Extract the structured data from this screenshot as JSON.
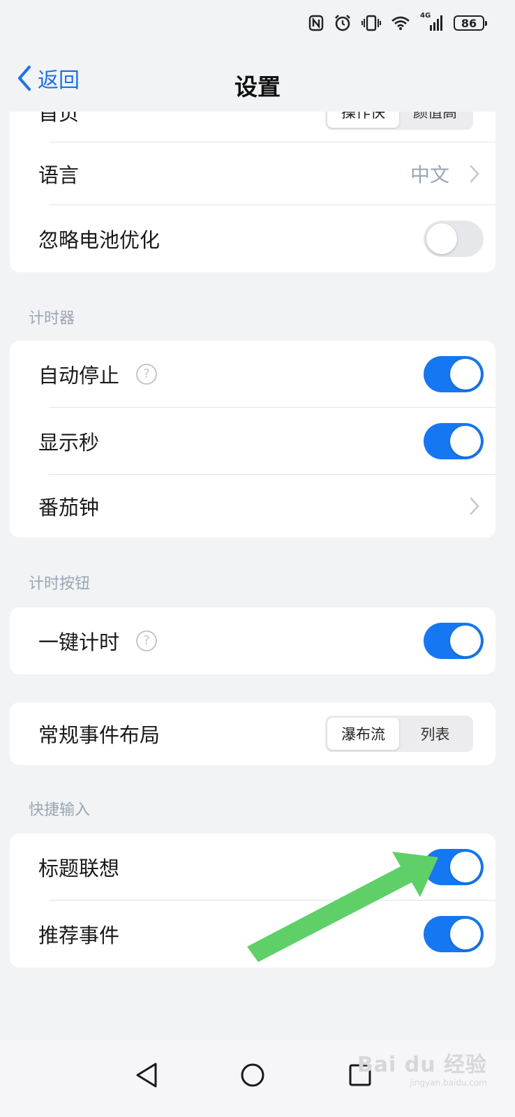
{
  "status_bar": {
    "battery": "86",
    "network": "4G",
    "icons": [
      "nfc-icon",
      "alarm-icon",
      "vibrate-icon",
      "wifi-icon",
      "signal-icon",
      "battery-icon"
    ]
  },
  "header": {
    "back_label": "返回",
    "title": "设置"
  },
  "group_top": {
    "home_label": "首页",
    "home_options": [
      "操作快",
      "颜值高"
    ],
    "home_selected": "操作快",
    "language_label": "语言",
    "language_value": "中文",
    "battery_opt_label": "忽略电池优化",
    "battery_opt_on": false
  },
  "timer": {
    "section_title": "计时器",
    "auto_stop_label": "自动停止",
    "auto_stop_on": true,
    "show_seconds_label": "显示秒",
    "show_seconds_on": true,
    "pomodoro_label": "番茄钟"
  },
  "timer_button": {
    "section_title": "计时按钮",
    "one_tap_label": "一键计时",
    "one_tap_on": true
  },
  "layout": {
    "label": "常规事件布局",
    "options": [
      "瀑布流",
      "列表"
    ],
    "selected": "瀑布流"
  },
  "quick_input": {
    "section_title": "快捷输入",
    "title_suggest_label": "标题联想",
    "title_suggest_on": true,
    "recommend_label": "推荐事件",
    "recommend_on": true
  },
  "watermark": {
    "brand": "Bai du 经验",
    "url": "jingyan.baidu.com"
  },
  "colors": {
    "accent": "#1677f2",
    "annotation_arrow": "#5fd068"
  }
}
